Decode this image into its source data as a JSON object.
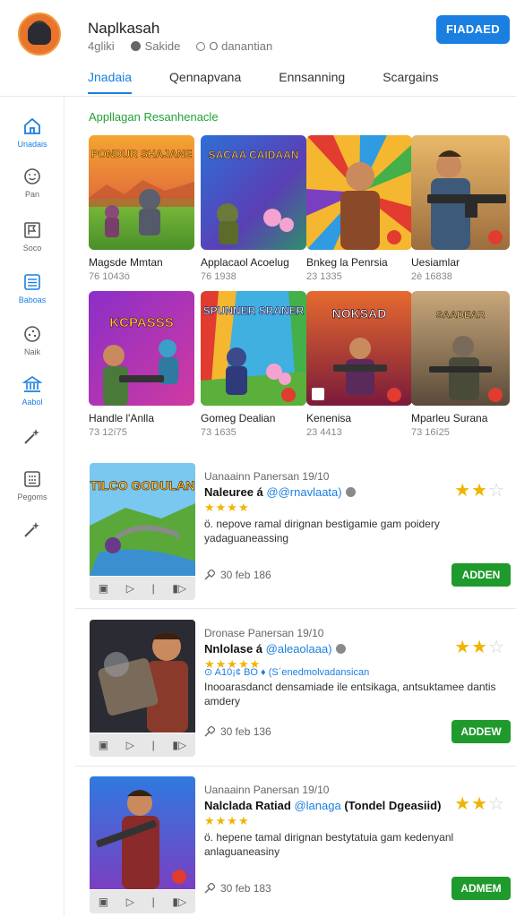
{
  "header": {
    "app_name": "Naplkasah",
    "meta": [
      "4gliki",
      "Sakide",
      "O danantian"
    ],
    "primary_button": "FIADAED",
    "tabs": [
      "Jnadaia",
      "Qennapvana",
      "Ennsanning",
      "Scargains"
    ]
  },
  "sidebar": {
    "items": [
      {
        "label": "Unadais",
        "icon": "home-icon"
      },
      {
        "label": "Pan",
        "icon": "smiley-icon"
      },
      {
        "label": "Soco",
        "icon": "flag-icon"
      },
      {
        "label": "Baboas",
        "icon": "list-icon"
      },
      {
        "label": "Naik",
        "icon": "compass-icon"
      },
      {
        "label": "Aabol",
        "icon": "bank-icon"
      },
      {
        "label": "",
        "icon": "magic-wand-icon"
      },
      {
        "label": "Pegoms",
        "icon": "grid-icon"
      },
      {
        "label": "",
        "icon": "magic-wand-icon"
      }
    ]
  },
  "section": {
    "title": "Appllagan Resanhenacle"
  },
  "games": [
    {
      "title": "Magsde Mmtan",
      "sub": "76 1043ö",
      "art": "PONDUR SHAJANE"
    },
    {
      "title": "Applacaol Acoelug",
      "sub": "76 1938",
      "art": "SACAA CAIDAAN"
    },
    {
      "title": "Bnkeg la Penrsia",
      "sub": "23 1335",
      "art": ""
    },
    {
      "title": "Uesiamlar",
      "sub": "2è 16838",
      "art": ""
    },
    {
      "title": "Handle l'Anlla",
      "sub": "73 12í75",
      "art": "KCPASSS"
    },
    {
      "title": "Gomeg Dealian",
      "sub": "73 1635",
      "art": "SPUNNER SRANER"
    },
    {
      "title": "Kenenisa",
      "sub": "23 4413",
      "art": "NOKSAD"
    },
    {
      "title": "Mparleu Surana",
      "sub": "73 16í25",
      "art": "SAADEAR"
    }
  ],
  "reviews": [
    {
      "header": "Uanaainn Panersan  19/10",
      "name": "Naleuree á",
      "handle": "@@rnavlaata)",
      "stars": "★★★★",
      "rating_on": "★★",
      "rating_off": "☆",
      "tag": "",
      "body": "ö. nepove ramal dirignan bestigamie gam poidery yadaguaneassing",
      "date": "30 feb 186",
      "button": "ADDEN",
      "art": "TILCO GODULAN"
    },
    {
      "header": "Dronase Panersan  19/10",
      "name": "Nnlolase á",
      "handle": "@aleaolaaa)",
      "stars": "★★★★★",
      "rating_on": "★★",
      "rating_off": "☆",
      "tag": "⊙ A10¡¢ BO ♦ (S´еnedmolvadansican",
      "body": "Inooarasdanct densamiade ile entsikaga, antsuktamee dantis amdery",
      "date": "30 feb 136",
      "button": "ADDEW",
      "art": ""
    },
    {
      "header": "Uanaainn Panersan  19/10",
      "name": "Nalclada Ratiad",
      "handle": "@lanaga",
      "name_suffix": "(Tondel Dgeasiid)",
      "stars": "★★★★",
      "rating_on": "★★",
      "rating_off": "☆",
      "tag": "",
      "body": "ö. hepene tamal dirignan bestytatuia gam kedenyanl anlaguaneasiny",
      "date": "30 feb 183",
      "button": "ADMEM",
      "art": ""
    }
  ],
  "colors": {
    "accent_blue": "#1a7fe0",
    "accent_green": "#1f9a2c",
    "star": "#f0b400"
  }
}
